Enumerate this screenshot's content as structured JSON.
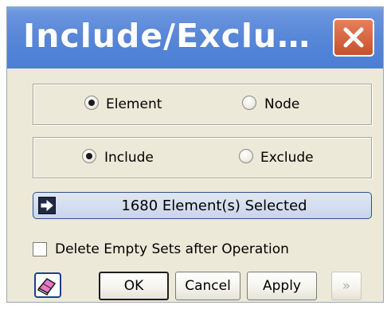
{
  "window": {
    "title": "Include/Exclu…"
  },
  "entity_group": {
    "options": [
      {
        "label": "Element",
        "checked": true
      },
      {
        "label": "Node",
        "checked": false
      }
    ]
  },
  "mode_group": {
    "options": [
      {
        "label": "Include",
        "checked": true
      },
      {
        "label": "Exclude",
        "checked": false
      }
    ]
  },
  "selection": {
    "text": "1680 Element(s) Selected"
  },
  "delete_empty_sets": {
    "label": "Delete Empty Sets after Operation",
    "checked": false
  },
  "buttons": {
    "ok": "OK",
    "cancel": "Cancel",
    "apply": "Apply",
    "more": "»"
  },
  "icons": {
    "close": "close-icon",
    "select_arrow": "arrow-right-icon",
    "eraser": "eraser-icon"
  },
  "colors": {
    "titlebar": "#5a88d8",
    "close_button": "#d96a46",
    "dialog_background": "#ece9d8"
  }
}
